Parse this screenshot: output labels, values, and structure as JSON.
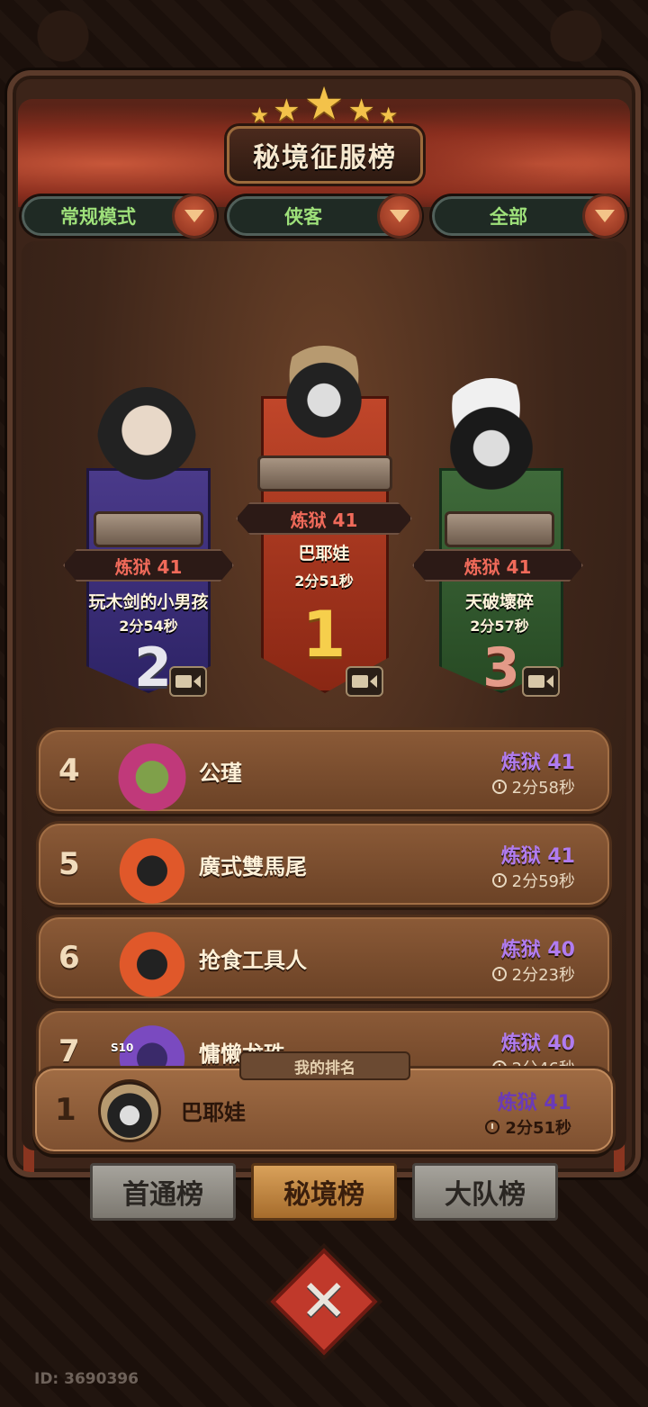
{
  "title": "秘境征服榜",
  "filters": [
    {
      "label": "常规模式"
    },
    {
      "label": "侠客"
    },
    {
      "label": "全部"
    }
  ],
  "podium": {
    "first": {
      "rank": "1",
      "level": "炼狱 41",
      "name": "巴耶娃",
      "time": "2分51秒"
    },
    "second": {
      "rank": "2",
      "level": "炼狱 41",
      "name": "玩木剑的小男孩",
      "time": "2分54秒"
    },
    "third": {
      "rank": "3",
      "level": "炼狱 41",
      "name": "天破壞碎",
      "time": "2分57秒"
    }
  },
  "rows": [
    {
      "rank": "4",
      "name": "公瑾",
      "level": "炼狱 41",
      "time": "2分58秒"
    },
    {
      "rank": "5",
      "name": "廣式雙馬尾",
      "level": "炼狱 41",
      "time": "2分59秒"
    },
    {
      "rank": "6",
      "name": "抢食工具人",
      "level": "炼狱 40",
      "time": "2分23秒"
    },
    {
      "rank": "7",
      "name": "慵懒龙珠",
      "level": "炼狱 40",
      "time": "2分46秒",
      "badge": "S10"
    }
  ],
  "my_rank": {
    "tag": "我的排名",
    "rank": "1",
    "name": "巴耶娃",
    "level": "炼狱 41",
    "time": "2分51秒"
  },
  "tabs": [
    {
      "label": "首通榜",
      "active": false
    },
    {
      "label": "秘境榜",
      "active": true
    },
    {
      "label": "大队榜",
      "active": false
    }
  ],
  "close_symbol": "✕",
  "footer_id": "ID: 3690396",
  "colors": {
    "level_purple": "#b07cf0",
    "level_red": "#f06a5a",
    "filter_green": "#9ee07a",
    "active_tab": "#d9a15a"
  }
}
